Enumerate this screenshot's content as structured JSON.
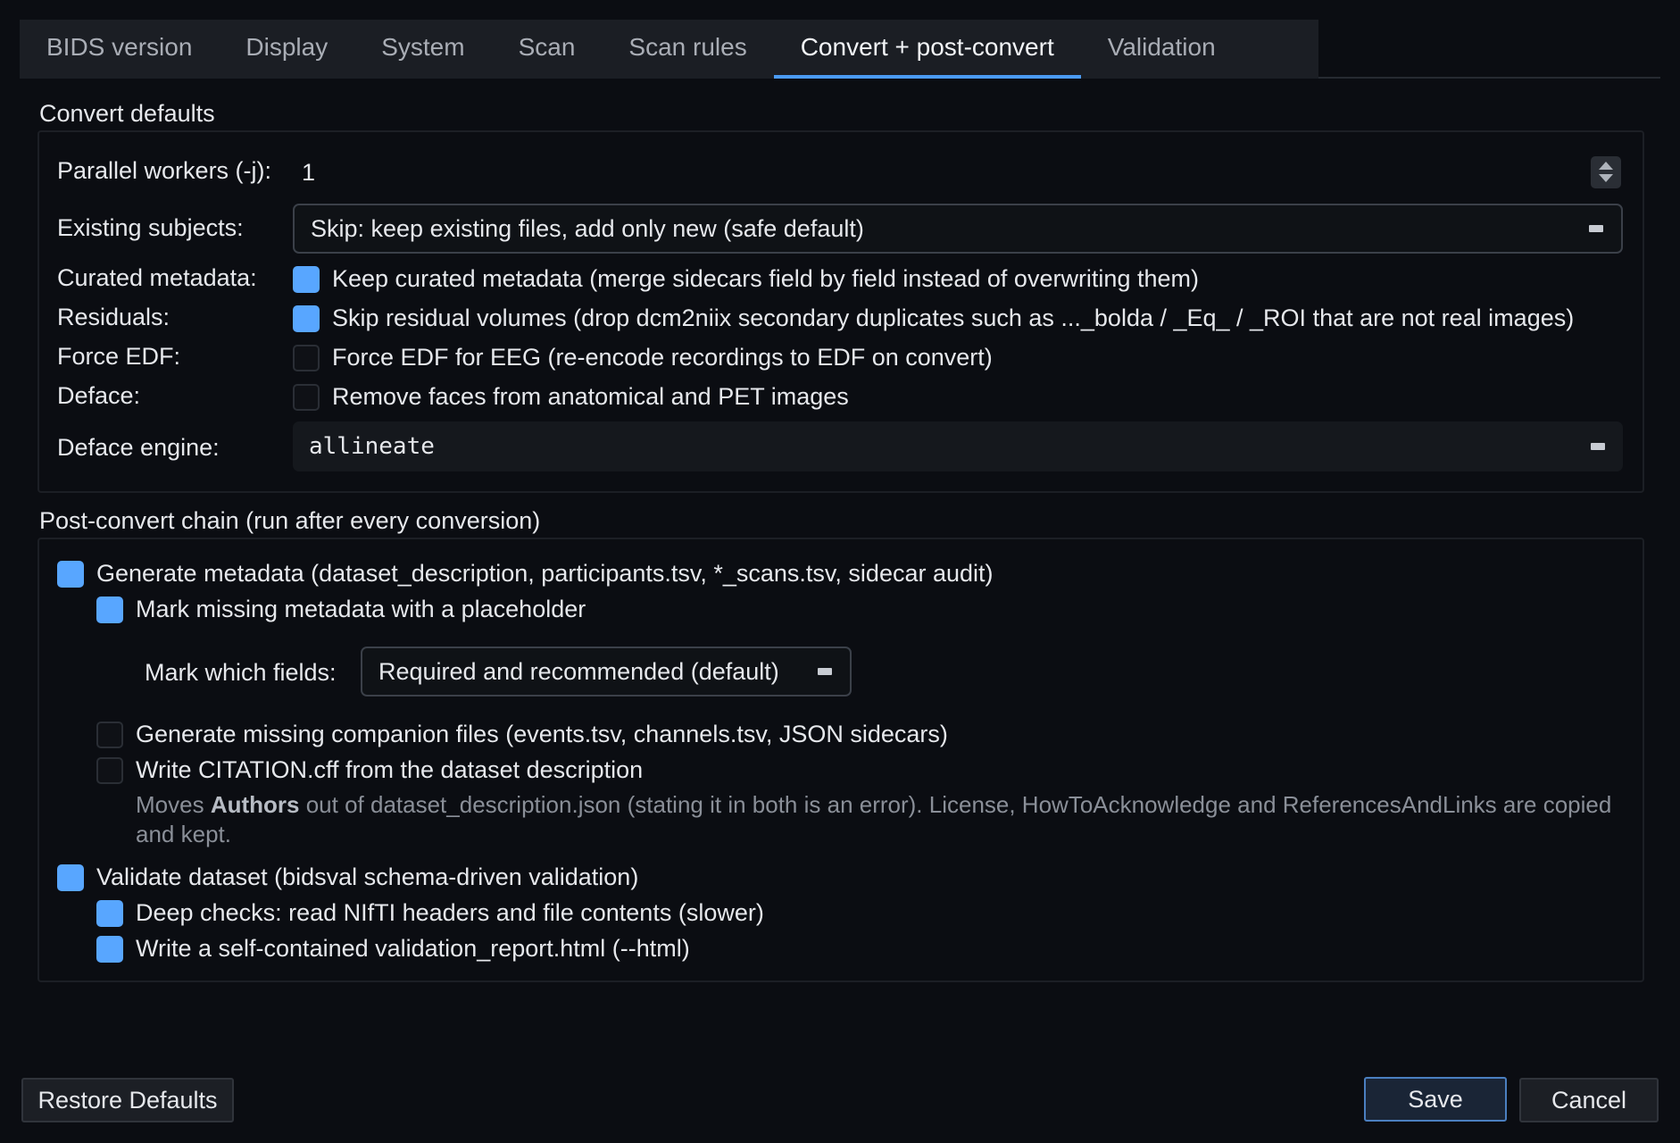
{
  "tabs": [
    {
      "label": "BIDS version",
      "active": false
    },
    {
      "label": "Display",
      "active": false
    },
    {
      "label": "System",
      "active": false
    },
    {
      "label": "Scan",
      "active": false
    },
    {
      "label": "Scan rules",
      "active": false
    },
    {
      "label": "Convert + post-convert",
      "active": true
    },
    {
      "label": "Validation",
      "active": false
    }
  ],
  "convert_defaults": {
    "title": "Convert defaults",
    "parallel_workers": {
      "label": "Parallel workers (-j):",
      "value": "1"
    },
    "existing_subjects": {
      "label": "Existing subjects:",
      "value": "Skip: keep existing files, add only new (safe default)"
    },
    "curated_metadata": {
      "label": "Curated metadata:",
      "text": "Keep curated metadata (merge sidecars field by field instead of overwriting them)",
      "checked": true
    },
    "residuals": {
      "label": "Residuals:",
      "text": "Skip residual volumes (drop dcm2niix secondary duplicates such as ..._bolda / _Eq_ / _ROI that are not real images)",
      "checked": true
    },
    "force_edf": {
      "label": "Force EDF:",
      "text": "Force EDF for EEG (re-encode recordings to EDF on convert)",
      "checked": false
    },
    "deface": {
      "label": "Deface:",
      "text": "Remove faces from anatomical and PET images",
      "checked": false
    },
    "deface_engine": {
      "label": "Deface engine:",
      "value": "allineate"
    }
  },
  "post_convert": {
    "title": "Post-convert chain (run after every conversion)",
    "generate_metadata": {
      "text": "Generate metadata (dataset_description, participants.tsv, *_scans.tsv, sidecar audit)",
      "checked": true
    },
    "mark_missing": {
      "text": "Mark missing metadata with a placeholder",
      "checked": true
    },
    "mark_which": {
      "label": "Mark which fields:",
      "value": "Required and recommended (default)"
    },
    "companion_files": {
      "text": "Generate missing companion files (events.tsv, channels.tsv, JSON sidecars)",
      "checked": false
    },
    "citation": {
      "text": "Write CITATION.cff from the dataset description",
      "checked": false
    },
    "citation_note": {
      "pre": "Moves ",
      "bold": "Authors",
      "post": " out of dataset_description.json (stating it in both is an error). License, HowToAcknowledge and ReferencesAndLinks are copied and kept."
    },
    "validate": {
      "text": "Validate dataset (bidsval schema-driven validation)",
      "checked": true
    },
    "deep_checks": {
      "text": "Deep checks: read NIfTI headers and file contents (slower)",
      "checked": true
    },
    "write_report": {
      "text": "Write a self-contained validation_report.html (--html)",
      "checked": true
    }
  },
  "buttons": {
    "restore": "Restore Defaults",
    "save": "Save",
    "cancel": "Cancel"
  },
  "colors": {
    "accent": "#58a6ff",
    "background": "#0b0d12"
  }
}
